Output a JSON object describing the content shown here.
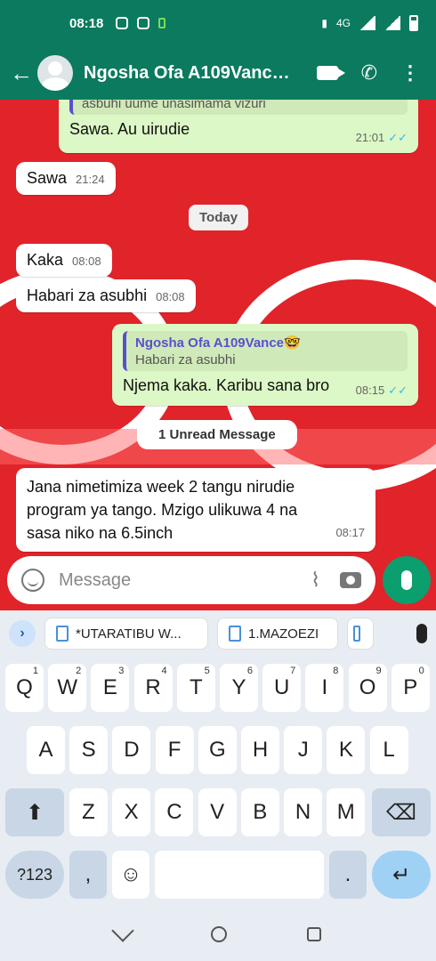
{
  "status": {
    "time": "08:18",
    "network": "4G"
  },
  "header": {
    "title": "Ngosha Ofa A109Vance…"
  },
  "messages": {
    "m1_quote_text": "asbuhi uume unasimama vizuri",
    "m1_text": "Sawa. Au uirudie",
    "m1_time": "21:01",
    "m2_text": "Sawa",
    "m2_time": "21:24",
    "day": "Today",
    "m3_text": "Kaka",
    "m3_time": "08:08",
    "m4_text": "Habari za asubhi",
    "m4_time": "08:08",
    "m5_quote_name": "Ngosha Ofa A109Vance🤓",
    "m5_quote_text": "Habari za asubhi",
    "m5_text": "Njema kaka. Karibu sana bro",
    "m5_time": "08:15",
    "unread": "1 Unread Message",
    "m6_line1": "Jana nimetimiza week 2 tangu nirudie",
    "m6_line2": "program ya tango. Mzigo ulikuwa 4 na",
    "m6_line3": "sasa niko na 6.5inch",
    "m6_time": "08:17"
  },
  "input": {
    "placeholder": "Message"
  },
  "keyboard": {
    "suggestions": [
      "*UTARATIBU W...",
      "1.MAZOEZI"
    ],
    "row1": [
      "Q",
      "W",
      "E",
      "R",
      "T",
      "Y",
      "U",
      "I",
      "O",
      "P"
    ],
    "row1_nums": [
      "1",
      "2",
      "3",
      "4",
      "5",
      "6",
      "7",
      "8",
      "9",
      "0"
    ],
    "row2": [
      "A",
      "S",
      "D",
      "F",
      "G",
      "H",
      "J",
      "K",
      "L"
    ],
    "row3": [
      "Z",
      "X",
      "C",
      "V",
      "B",
      "N",
      "M"
    ],
    "sym": "?123",
    "comma": ",",
    "period": "."
  },
  "colors": {
    "header": "#0b7a5e",
    "wallpaper": "#e1232a",
    "outgoing": "#dcf8c6",
    "mic": "#0b9e6e"
  }
}
